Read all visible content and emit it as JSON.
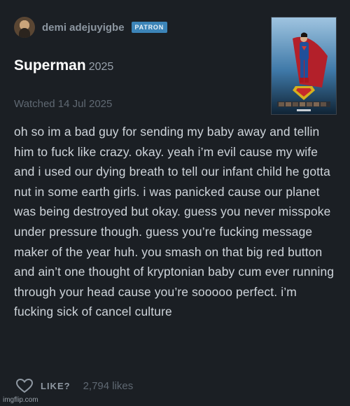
{
  "author": {
    "name": "demi adejuyigbe",
    "badge": "PATRON",
    "avatar_icon": "user-avatar"
  },
  "film": {
    "title": "Superman",
    "year": "2025",
    "poster_icon": "superman-poster"
  },
  "watched_label": "Watched 14 Jul 2025",
  "review_text": "oh so im a bad guy for sending my baby away and tellin him to fuck like crazy. okay. yeah i’m evil cause my wife and i used our dying breath to tell our infant child he gotta nut in some earth girls. i was panicked cause our planet was being destroyed but okay. guess you never misspoke under pressure though. guess you’re fucking message maker of the year huh. you smash on that big red button and ain’t one thought of kryptonian baby cum ever running through your head cause you’re sooooo perfect. i’m fucking sick of cancel culture",
  "footer": {
    "like_label": "LIKE?",
    "like_count": "2,794 likes",
    "heart_icon": "heart-outline"
  },
  "watermark": "imgflip.com",
  "colors": {
    "background": "#1b1f24",
    "patron_badge": "#3c84b8",
    "title": "#ffffff",
    "body_text": "#cfd5db",
    "muted": "#5f6872"
  }
}
